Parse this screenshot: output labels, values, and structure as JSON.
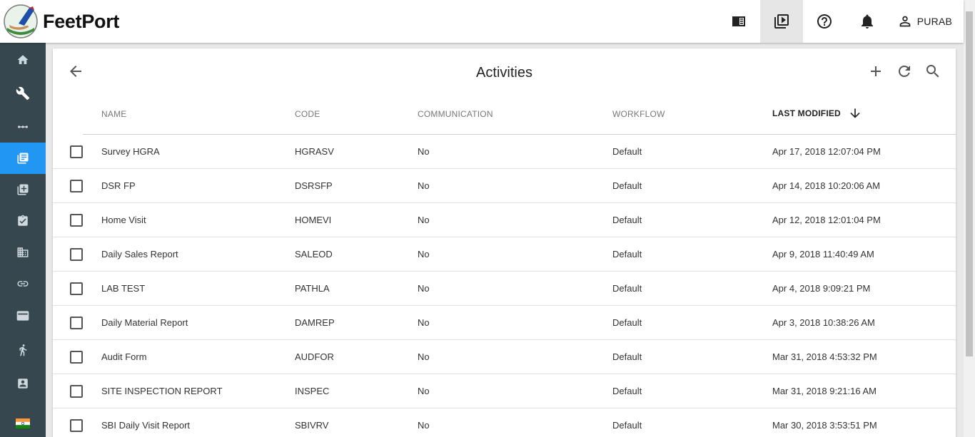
{
  "app": {
    "brand": "FeetPort",
    "user_name": "PURAB"
  },
  "topbar": {
    "icons": [
      "panel-icon",
      "video-library-icon",
      "help-icon",
      "notifications-icon",
      "person-icon"
    ]
  },
  "sidebar": {
    "items": [
      {
        "icon": "home-icon",
        "active": false
      },
      {
        "icon": "wrench-icon",
        "active": false
      },
      {
        "icon": "dots-icon",
        "active": false
      },
      {
        "icon": "activities-icon",
        "active": true
      },
      {
        "icon": "library-icon",
        "active": false
      },
      {
        "icon": "clipboard-check-icon",
        "active": false
      },
      {
        "icon": "building-icon",
        "active": false
      },
      {
        "icon": "link-icon",
        "active": false
      },
      {
        "icon": "card-icon",
        "active": false
      },
      {
        "icon": "walk-icon",
        "active": false
      },
      {
        "icon": "contact-card-icon",
        "active": false
      }
    ],
    "flag": "india-flag-icon"
  },
  "page": {
    "title": "Activities"
  },
  "table": {
    "columns": {
      "name": "NAME",
      "code": "CODE",
      "communication": "COMMUNICATION",
      "workflow": "WORKFLOW",
      "last_modified": "LAST MODIFIED"
    },
    "rows": [
      {
        "name": "Survey HGRA",
        "code": "HGRASV",
        "communication": "No",
        "workflow": "Default",
        "last_modified": "Apr 17, 2018 12:07:04 PM"
      },
      {
        "name": "DSR FP",
        "code": "DSRSFP",
        "communication": "No",
        "workflow": "Default",
        "last_modified": "Apr 14, 2018 10:20:06 AM"
      },
      {
        "name": "Home Visit",
        "code": "HOMEVI",
        "communication": "No",
        "workflow": "Default",
        "last_modified": "Apr 12, 2018 12:01:04 PM"
      },
      {
        "name": "Daily Sales Report",
        "code": "SALEOD",
        "communication": "No",
        "workflow": "Default",
        "last_modified": "Apr 9, 2018 11:40:49 AM"
      },
      {
        "name": "LAB TEST",
        "code": "PATHLA",
        "communication": "No",
        "workflow": "Default",
        "last_modified": "Apr 4, 2018 9:09:21 PM"
      },
      {
        "name": "Daily Material Report",
        "code": "DAMREP",
        "communication": "No",
        "workflow": "Default",
        "last_modified": "Apr 3, 2018 10:38:26 AM"
      },
      {
        "name": "Audit Form",
        "code": "AUDFOR",
        "communication": "No",
        "workflow": "Default",
        "last_modified": "Mar 31, 2018 4:53:32 PM"
      },
      {
        "name": "SITE INSPECTION REPORT",
        "code": "INSPEC",
        "communication": "No",
        "workflow": "Default",
        "last_modified": "Mar 31, 2018 9:21:16 AM"
      },
      {
        "name": "SBI Daily Visit Report",
        "code": "SBIVRV",
        "communication": "No",
        "workflow": "Default",
        "last_modified": "Mar 30, 2018 3:53:51 PM"
      }
    ]
  },
  "colors": {
    "sidebar_bg": "#37474f",
    "sidebar_active": "#2196f3"
  }
}
